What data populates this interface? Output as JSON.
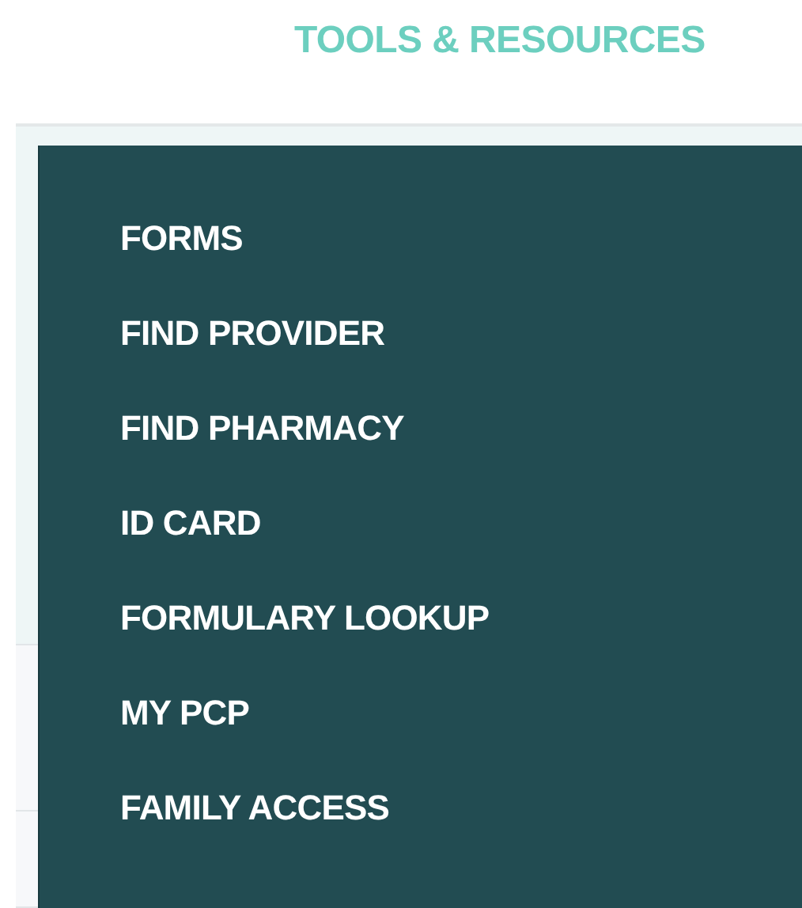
{
  "header": {
    "title": "TOOLS & RESOURCES"
  },
  "menu": {
    "items": [
      {
        "label": "FORMS"
      },
      {
        "label": "FIND PROVIDER"
      },
      {
        "label": "FIND PHARMACY"
      },
      {
        "label": "ID CARD"
      },
      {
        "label": "FORMULARY LOOKUP"
      },
      {
        "label": "MY PCP"
      },
      {
        "label": "FAMILY ACCESS"
      }
    ]
  }
}
